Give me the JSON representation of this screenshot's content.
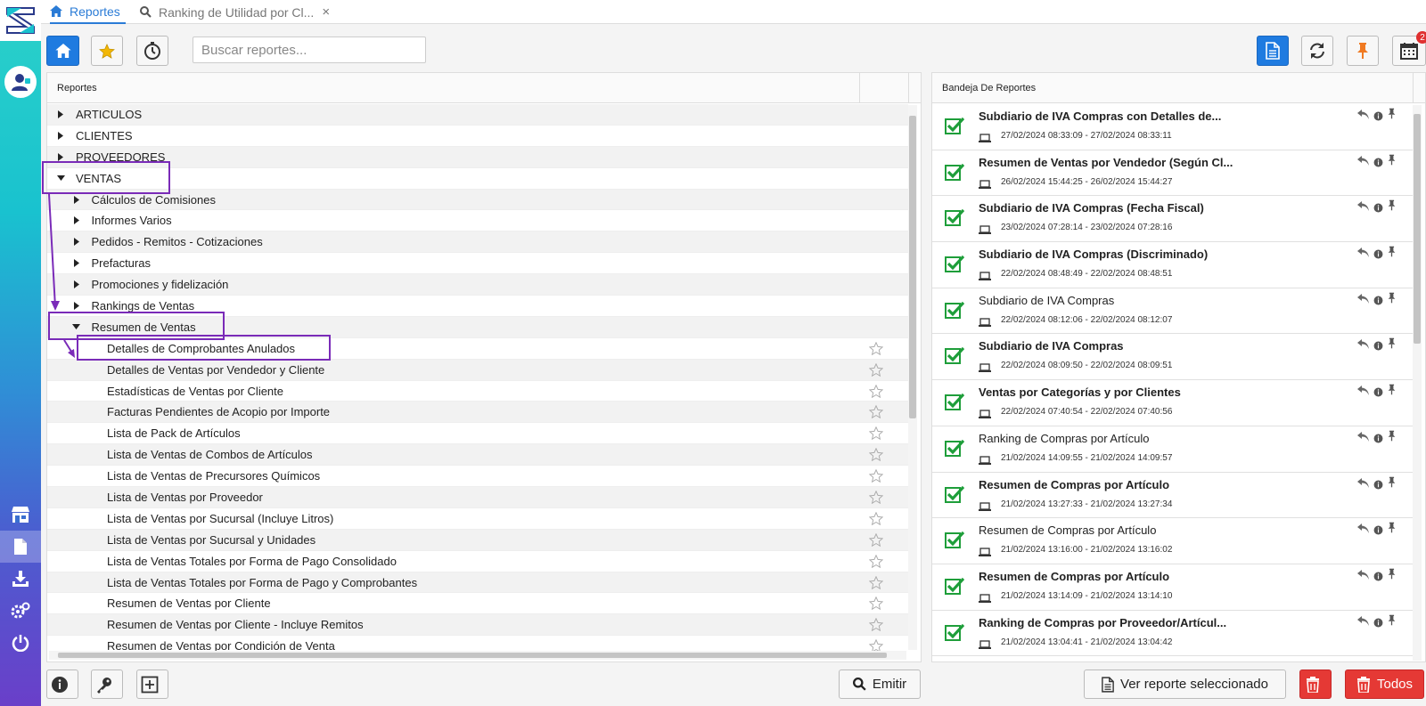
{
  "tabs": [
    {
      "label": "Reportes",
      "icon": "home-icon"
    },
    {
      "label": "Ranking de Utilidad por Cl...",
      "icon": "search-icon",
      "close": "×"
    }
  ],
  "search": {
    "placeholder": "Buscar reportes..."
  },
  "notifications_badge": "2",
  "left_panel": {
    "header": "Reportes",
    "rows": [
      {
        "label": "ARTICULOS",
        "level": 0,
        "caret": "right"
      },
      {
        "label": "CLIENTES",
        "level": 0,
        "caret": "right"
      },
      {
        "label": "PROVEEDORES",
        "level": 0,
        "caret": "right"
      },
      {
        "label": "VENTAS",
        "level": 0,
        "caret": "down"
      },
      {
        "label": "Cálculos de Comisiones",
        "level": 1,
        "caret": "right"
      },
      {
        "label": "Informes Varios",
        "level": 1,
        "caret": "right"
      },
      {
        "label": "Pedidos - Remitos - Cotizaciones",
        "level": 1,
        "caret": "right"
      },
      {
        "label": "Prefacturas",
        "level": 1,
        "caret": "right"
      },
      {
        "label": "Promociones y fidelización",
        "level": 1,
        "caret": "right"
      },
      {
        "label": "Rankings de Ventas",
        "level": 1,
        "caret": "right"
      },
      {
        "label": "Resumen de Ventas",
        "level": 1,
        "caret": "down"
      },
      {
        "label": "Detalles de Comprobantes Anulados",
        "level": 2,
        "star": true
      },
      {
        "label": "Detalles de Ventas por Vendedor y Cliente",
        "level": 2,
        "star": true
      },
      {
        "label": "Estadísticas de Ventas por Cliente",
        "level": 2,
        "star": true
      },
      {
        "label": "Facturas Pendientes de Acopio por Importe",
        "level": 2,
        "star": true
      },
      {
        "label": "Lista de Pack de Artículos",
        "level": 2,
        "star": true
      },
      {
        "label": "Lista de Ventas de Combos de Artículos",
        "level": 2,
        "star": true
      },
      {
        "label": "Lista de Ventas de Precursores Químicos",
        "level": 2,
        "star": true
      },
      {
        "label": "Lista de Ventas por Proveedor",
        "level": 2,
        "star": true
      },
      {
        "label": "Lista de Ventas por Sucursal (Incluye Litros)",
        "level": 2,
        "star": true
      },
      {
        "label": "Lista de Ventas por Sucursal y Unidades",
        "level": 2,
        "star": true
      },
      {
        "label": "Lista de Ventas Totales por Forma de Pago Consolidado",
        "level": 2,
        "star": true
      },
      {
        "label": "Lista de Ventas Totales por Forma de Pago y Comprobantes",
        "level": 2,
        "star": true
      },
      {
        "label": "Resumen de Ventas por Cliente",
        "level": 2,
        "star": true
      },
      {
        "label": "Resumen de Ventas por Cliente - Incluye Remitos",
        "level": 2,
        "star": true
      },
      {
        "label": "Resumen de Ventas por Condición de Venta",
        "level": 2,
        "star": true
      }
    ]
  },
  "right_panel": {
    "header": "Bandeja De Reportes",
    "items": [
      {
        "title": "Subdiario de IVA Compras con Detalles de...",
        "bold": true,
        "date": "27/02/2024 08:33:09 - 27/02/2024 08:33:11"
      },
      {
        "title": "Resumen de Ventas por Vendedor (Según Cl...",
        "bold": true,
        "date": "26/02/2024 15:44:25 - 26/02/2024 15:44:27"
      },
      {
        "title": "Subdiario de IVA Compras (Fecha Fiscal)",
        "bold": true,
        "date": "23/02/2024 07:28:14 - 23/02/2024 07:28:16"
      },
      {
        "title": "Subdiario de IVA Compras (Discriminado)",
        "bold": true,
        "date": "22/02/2024 08:48:49 - 22/02/2024 08:48:51"
      },
      {
        "title": "Subdiario de IVA Compras",
        "bold": false,
        "date": "22/02/2024 08:12:06 - 22/02/2024 08:12:07"
      },
      {
        "title": "Subdiario de IVA Compras",
        "bold": true,
        "date": "22/02/2024 08:09:50 - 22/02/2024 08:09:51"
      },
      {
        "title": "Ventas por Categorías y por Clientes",
        "bold": true,
        "date": "22/02/2024 07:40:54 - 22/02/2024 07:40:56"
      },
      {
        "title": "Ranking de Compras por Artículo",
        "bold": false,
        "date": "21/02/2024 14:09:55 - 21/02/2024 14:09:57"
      },
      {
        "title": "Resumen de Compras por Artículo",
        "bold": true,
        "date": "21/02/2024 13:27:33 - 21/02/2024 13:27:34"
      },
      {
        "title": "Resumen de Compras por Artículo",
        "bold": false,
        "date": "21/02/2024 13:16:00 - 21/02/2024 13:16:02"
      },
      {
        "title": "Resumen de Compras por Artículo",
        "bold": true,
        "date": "21/02/2024 13:14:09 - 21/02/2024 13:14:10"
      },
      {
        "title": "Ranking de Compras por Proveedor/Artícul...",
        "bold": true,
        "date": "21/02/2024 13:04:41 - 21/02/2024 13:04:42"
      }
    ]
  },
  "bottom": {
    "emitir": "Emitir",
    "ver_reporte": "Ver reporte seleccionado",
    "todos": "Todos"
  },
  "colors": {
    "accent": "#1f7be0",
    "danger": "#e53935",
    "check": "#1e9e3a",
    "annotation": "#7a2bb8",
    "pin": "#f07a22"
  }
}
